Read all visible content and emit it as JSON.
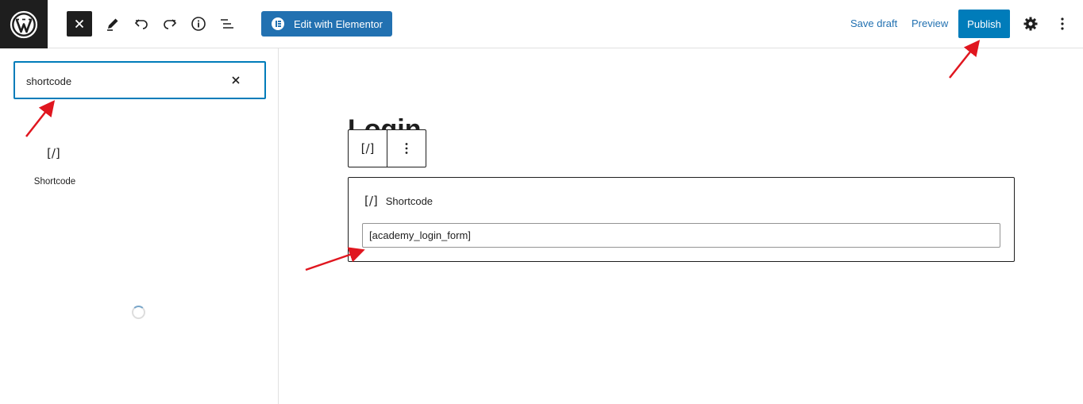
{
  "topbar": {
    "elementor_label": "Edit with Elementor",
    "save_draft_label": "Save draft",
    "preview_label": "Preview",
    "publish_label": "Publish"
  },
  "inserter": {
    "search_value": "shortcode",
    "block_icon": "[/]",
    "block_label": "Shortcode"
  },
  "editor": {
    "title": "Login",
    "toolbar_block_icon": "[/]",
    "shortcode_block": {
      "icon": "[/]",
      "label": "Shortcode",
      "value": "[academy_login_form]"
    }
  },
  "icons": [
    "wordpress-logo",
    "close-icon",
    "pencil-icon",
    "undo-icon",
    "redo-icon",
    "info-icon",
    "list-view-icon",
    "elementor-icon",
    "gear-icon",
    "more-vertical-icon",
    "search-clear-icon",
    "loading-spinner"
  ],
  "colors": {
    "accent": "#007cba",
    "elementor": "#2271b1",
    "annotation_arrow": "#e0161f"
  }
}
